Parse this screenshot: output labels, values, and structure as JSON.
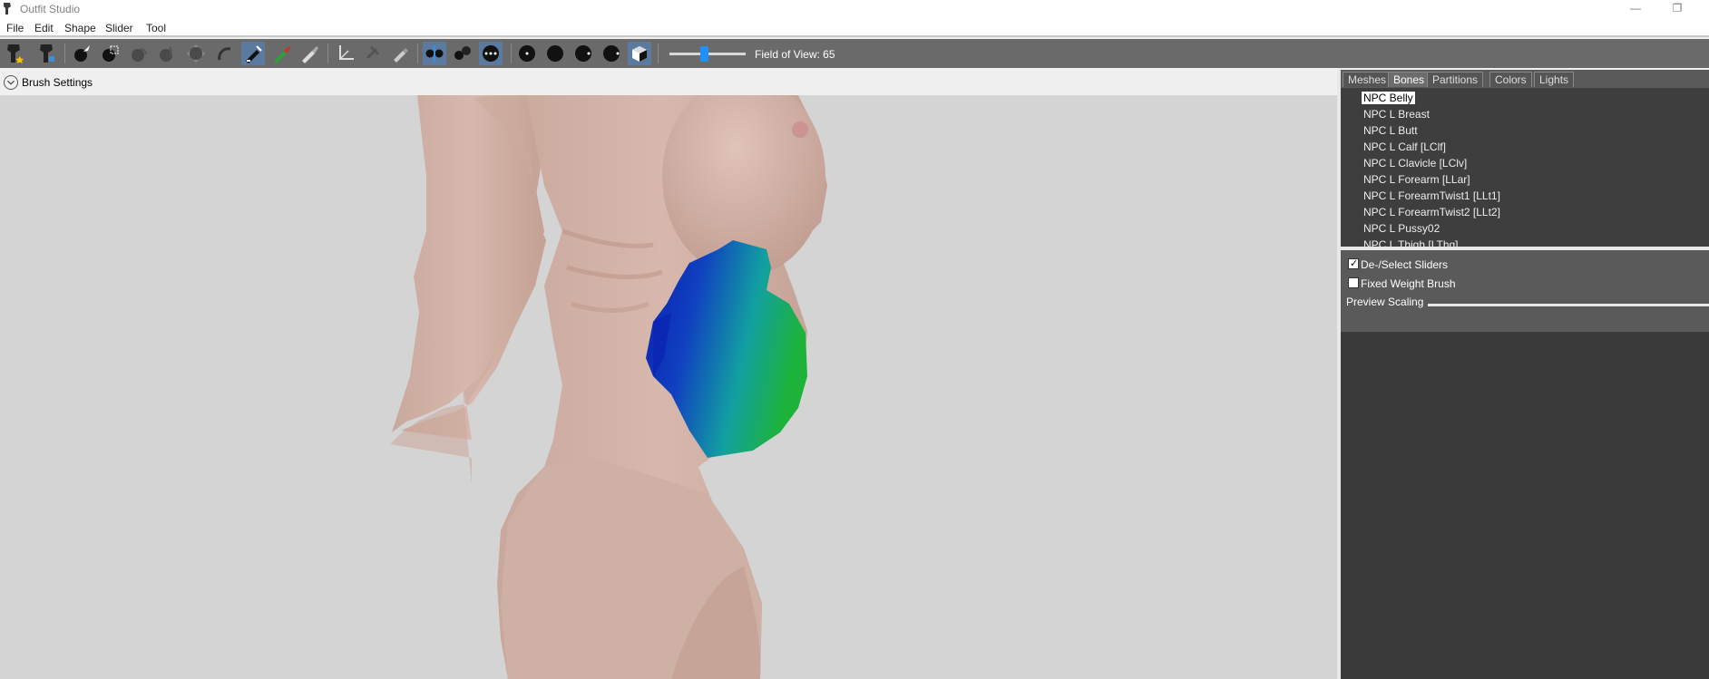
{
  "window": {
    "title": "Outfit Studio",
    "controls": [
      "—",
      "❐"
    ]
  },
  "menu": [
    "File",
    "Edit",
    "Shape",
    "Slider",
    "Tool"
  ],
  "toolbar": {
    "fov_label": "Field of View: 65",
    "fov_value": 65,
    "icons": [
      "load-reference-icon",
      "load-outfit-icon",
      "select-brush-icon",
      "mask-brush-icon",
      "inflate-brush-icon",
      "deflate-brush-icon",
      "move-brush-icon",
      "smooth-brush-icon",
      "weight-brush-icon",
      "color-brush-icon",
      "alpha-brush-icon",
      "transform-icon",
      "pivot-icon",
      "erase-icon",
      "x-mirror-icon",
      "connected-icon",
      "global-brush-icon",
      "vertex-view-icon",
      "wireframe-icon",
      "lighting-icon",
      "textures-icon",
      "mask-view-icon"
    ]
  },
  "brush_settings": {
    "label": "Brush Settings"
  },
  "right_panel": {
    "tabs": [
      "Meshes",
      "Bones",
      "Partitions",
      "Colors",
      "Lights"
    ],
    "active_tab": "Bones",
    "bones": [
      "NPC Belly",
      "NPC L Breast",
      "NPC L Butt",
      "NPC L Calf [LClf]",
      "NPC L Clavicle [LClv]",
      "NPC L Forearm [LLar]",
      "NPC L ForearmTwist1 [LLt1]",
      "NPC L ForearmTwist2 [LLt2]",
      "NPC L Pussy02",
      "NPC L Thigh [LThg]"
    ],
    "selected_bone": "NPC Belly",
    "options": {
      "deselect_sliders": {
        "label": "De-/Select Sliders",
        "checked": true
      },
      "fixed_weight": {
        "label": "Fixed Weight Brush",
        "checked": false
      },
      "preview_scaling": {
        "label": "Preview Scaling"
      }
    }
  },
  "colors": {
    "toolbar_bg": "#6a6a6a",
    "accent": "#1e90ff",
    "panel_bg": "#3a3a3a",
    "weight_high": "#1db33a",
    "weight_low": "#0a1fb0",
    "skin": "#d4b0a4"
  }
}
